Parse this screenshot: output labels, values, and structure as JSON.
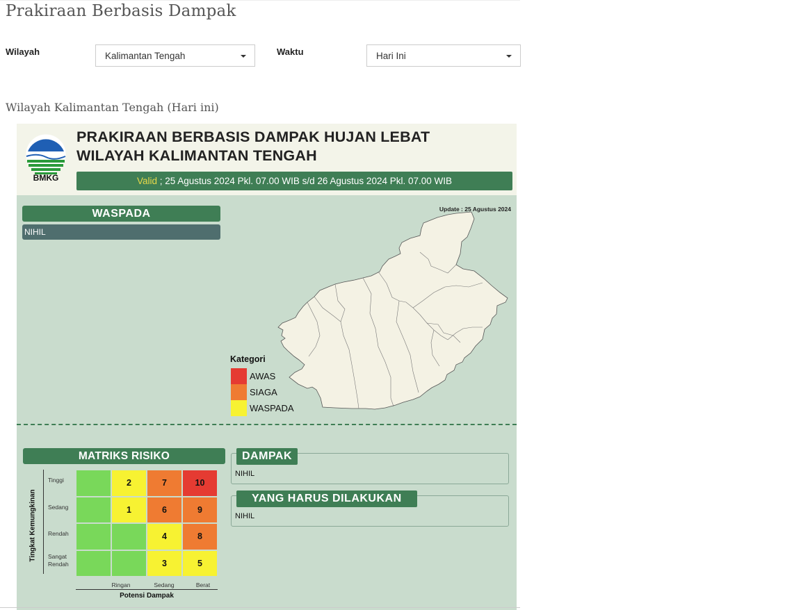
{
  "page": {
    "title": "Prakiraan Berbasis Dampak"
  },
  "filters": {
    "wilayah_label": "Wilayah",
    "wilayah_value": "Kalimantan Tengah",
    "waktu_label": "Waktu",
    "waktu_value": "Hari Ini"
  },
  "subtitle": "Wilayah Kalimantan Tengah (Hari ini)",
  "infographic": {
    "logo_text": "BMKG",
    "title_line1": "PRAKIRAAN BERBASIS DAMPAK HUJAN LEBAT",
    "title_line2": "WILAYAH KALIMANTAN TENGAH",
    "valid_word": "Valid",
    "valid_text": " ; 25 Agustus 2024 Pkl. 07.00 WIB s/d 26 Agustus 2024 Pkl. 07.00 WIB",
    "update": "Update : 25 Agustus 2024",
    "waspada_heading": "WASPADA",
    "waspada_value": "NIHIL",
    "legend": {
      "title": "Kategori",
      "items": [
        {
          "label": "AWAS",
          "color": "#e53b32"
        },
        {
          "label": "SIAGA",
          "color": "#ef7b32"
        },
        {
          "label": "WASPADA",
          "color": "#f7f232"
        }
      ]
    },
    "matrix": {
      "heading": "MATRIKS RISIKO",
      "y_axis": "Tingkat Kemungkinan",
      "x_axis": "Potensi Dampak",
      "rows": [
        "Tinggi",
        "Sedang",
        "Rendah",
        "Sangat Rendah"
      ],
      "cols": [
        "Ringan",
        "Sedang",
        "Berat"
      ],
      "cells": [
        [
          {
            "v": "",
            "c": "#79d85a"
          },
          {
            "v": "2",
            "c": "#f7f232"
          },
          {
            "v": "7",
            "c": "#ef7b32"
          },
          {
            "v": "10",
            "c": "#e53b32"
          }
        ],
        [
          {
            "v": "",
            "c": "#79d85a"
          },
          {
            "v": "1",
            "c": "#f7f232"
          },
          {
            "v": "6",
            "c": "#ef7b32"
          },
          {
            "v": "9",
            "c": "#ef7b32"
          }
        ],
        [
          {
            "v": "",
            "c": "#79d85a"
          },
          {
            "v": "",
            "c": "#79d85a"
          },
          {
            "v": "4",
            "c": "#f7f232"
          },
          {
            "v": "8",
            "c": "#ef7b32"
          }
        ],
        [
          {
            "v": "",
            "c": "#79d85a"
          },
          {
            "v": "",
            "c": "#79d85a"
          },
          {
            "v": "3",
            "c": "#f7f232"
          },
          {
            "v": "5",
            "c": "#f7f232"
          }
        ]
      ]
    },
    "dampak": {
      "heading": "DAMPAK",
      "value": "NIHIL"
    },
    "yang_harus": {
      "heading": "YANG HARUS DILAKUKAN",
      "value": "NIHIL"
    }
  }
}
